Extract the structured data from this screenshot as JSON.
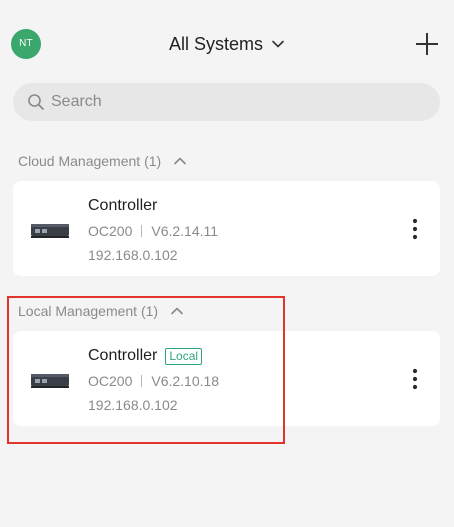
{
  "header": {
    "avatar_initials": "NT",
    "avatar_color": "#3aa76d",
    "title": "All Systems",
    "title_icon": "chevron-down-icon",
    "add_icon": "plus-icon"
  },
  "search": {
    "placeholder": "Search",
    "value": ""
  },
  "sections": [
    {
      "label": "Cloud Management (1)",
      "toggle_icon": "chevron-up-icon",
      "devices": [
        {
          "name": "Controller",
          "badge": "",
          "model": "OC200",
          "version": "V6.2.14.11",
          "ip": "192.168.0.102",
          "icon": "controller-device-icon"
        }
      ]
    },
    {
      "label": "Local Management (1)",
      "toggle_icon": "chevron-up-icon",
      "devices": [
        {
          "name": "Controller",
          "badge": "Local",
          "model": "OC200",
          "version": "V6.2.10.18",
          "ip": "192.168.0.102",
          "icon": "controller-device-icon"
        }
      ]
    }
  ],
  "colors": {
    "background": "#f4f4f4",
    "card": "#ffffff",
    "accent_green": "#2fa57a",
    "highlight_red": "#e2332c",
    "muted_text": "#8a8a8a"
  }
}
